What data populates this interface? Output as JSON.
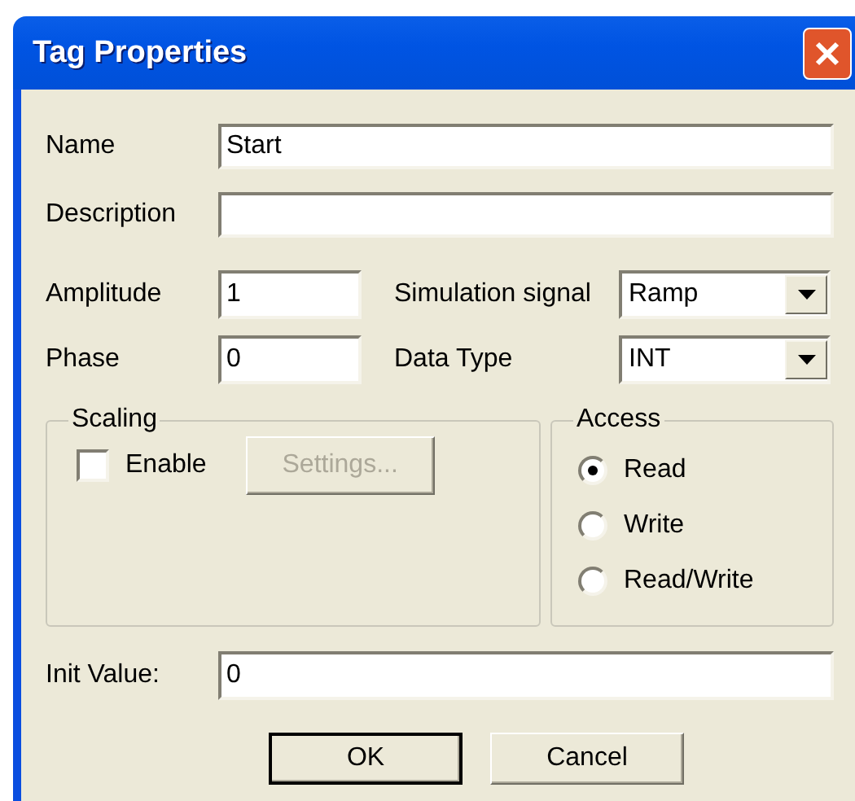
{
  "window": {
    "title": "Tag Properties"
  },
  "name": {
    "label": "Name",
    "value": "Start"
  },
  "description": {
    "label": "Description"
  },
  "amplitude": {
    "label": "Amplitude",
    "value": "1"
  },
  "simulation_signal": {
    "label": "Simulation signal",
    "value": "Ramp"
  },
  "phase": {
    "label": "Phase",
    "value": "0"
  },
  "data_type": {
    "label": "Data Type",
    "value": "INT"
  },
  "scaling": {
    "title": "Scaling",
    "enable": {
      "label": "Enable",
      "checked": false
    },
    "settings": {
      "label": "Settings...",
      "disabled": true
    }
  },
  "access": {
    "title": "Access",
    "options": [
      {
        "label": "Read",
        "selected": true
      },
      {
        "label": "Write",
        "selected": false
      },
      {
        "label": "Read/Write",
        "selected": false
      }
    ]
  },
  "init_value": {
    "label": "Init Value:",
    "value": "0"
  },
  "buttons": [
    {
      "label": "OK",
      "default": true
    },
    {
      "label": "Cancel",
      "default": false
    }
  ]
}
